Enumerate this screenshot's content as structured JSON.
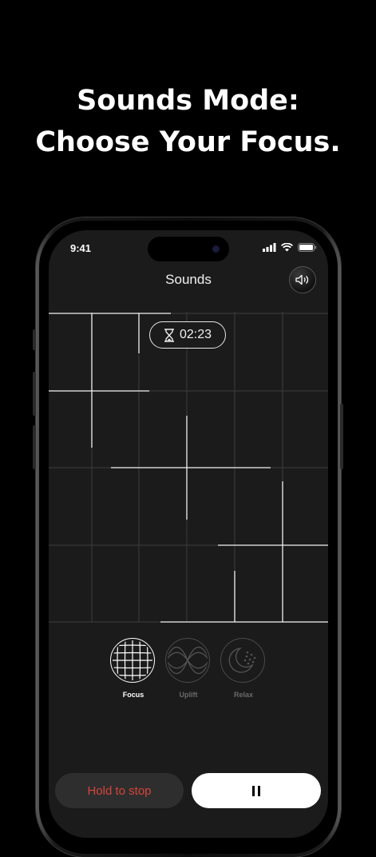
{
  "promo": {
    "headline_line1": "Sounds Mode:",
    "headline_line2": "Choose Your Focus."
  },
  "status_bar": {
    "time": "9:41",
    "icons": [
      "cellular-signal-icon",
      "wifi-icon",
      "battery-icon"
    ]
  },
  "nav": {
    "title": "Sounds",
    "volume_icon": "speaker-icon"
  },
  "timer": {
    "icon": "hourglass-icon",
    "value": "02:23"
  },
  "modes": [
    {
      "label": "Focus",
      "icon": "grid-sphere-icon",
      "selected": true
    },
    {
      "label": "Uplift",
      "icon": "wave-icon",
      "selected": false
    },
    {
      "label": "Relax",
      "icon": "moon-stars-icon",
      "selected": false
    }
  ],
  "controls": {
    "stop_label": "Hold to stop",
    "pause_icon": "pause-icon"
  },
  "colors": {
    "background": "#000000",
    "screen": "#1b1b1b",
    "stop_text": "#d6443a",
    "pause_button": "#ffffff"
  }
}
